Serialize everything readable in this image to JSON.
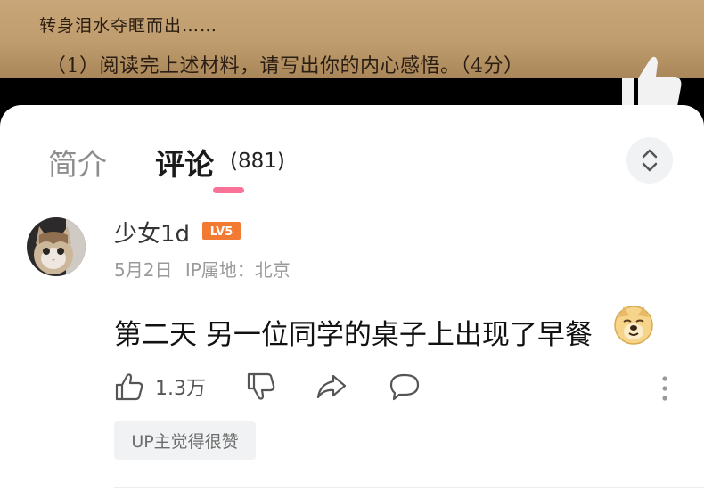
{
  "video": {
    "text_line_1": "转身泪水夺眶而出……",
    "text_line_2": "（1）阅读完上述材料，请写出你的内心感悟。（4分）"
  },
  "tabs": [
    {
      "label": "简介"
    },
    {
      "label": "评论",
      "count": "(881)"
    }
  ],
  "comment": {
    "username": "少女1d",
    "level": "LV5",
    "date": "5月2日",
    "ip_label": "IP属地：北京",
    "text": "第二天 另一位同学的桌子上出现了早餐",
    "emoji": "doge-emoji",
    "likes": "1.3万",
    "up_tag": "UP主觉得很赞"
  },
  "colors": {
    "accent_pink": "#fb7299",
    "level_orange": "#f27a32",
    "text_gray": "#9a9a9a",
    "tag_bg": "#f1f2f3"
  },
  "icons": [
    "thumbs-up-icon",
    "thumbs-down-icon",
    "share-icon",
    "reply-icon",
    "more-vertical-icon",
    "chevron-expand-icon"
  ]
}
